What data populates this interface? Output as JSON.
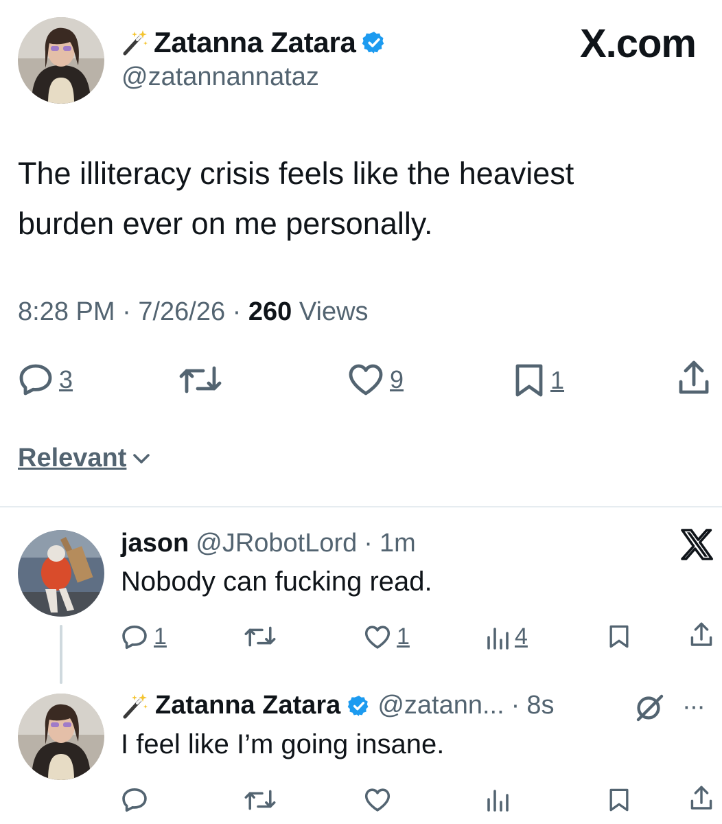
{
  "brand": "X.com",
  "tweet": {
    "author_name": "Zatanna Zatara",
    "author_handle": "@zatannannataz",
    "text": "The illiteracy crisis feels like the heaviest burden ever on me personally.",
    "time": "8:28 PM",
    "date": "7/26/26",
    "views_count": "260",
    "views_label": "Views",
    "separator": "·",
    "actions": {
      "replies": "3",
      "likes": "9",
      "bookmarks": "1"
    }
  },
  "sort": {
    "label": "Relevant"
  },
  "replies": [
    {
      "name": "jason",
      "handle": "@JRobotLord",
      "time": "1m",
      "text": "Nobody can fucking read.",
      "actions": {
        "replies": "1",
        "likes": "1",
        "views": "4"
      }
    },
    {
      "name": "Zatanna Zatara",
      "handle": "@zatann...",
      "time": "8s",
      "text": "I feel like I’m going insane.",
      "more": "···"
    }
  ],
  "colors": {
    "text": "#0f1419",
    "secondary": "#536471",
    "verified": "#1d9bf0",
    "divider": "#e6ecf0"
  }
}
